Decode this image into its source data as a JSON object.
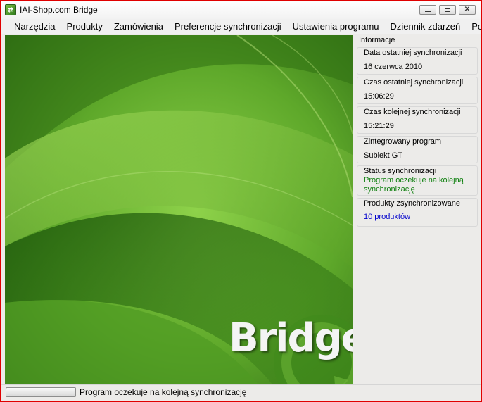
{
  "window": {
    "title": "IAI-Shop.com Bridge"
  },
  "menu": {
    "items": [
      "Narzędzia",
      "Produkty",
      "Zamówienia",
      "Preferencje synchronizacji",
      "Ustawienia programu",
      "Dziennik zdarzeń"
    ],
    "help": "Pomoc"
  },
  "banner": {
    "logo_text": "Bridge"
  },
  "info": {
    "legend": "Informacje",
    "last_sync_date": {
      "label": "Data ostatniej synchronizacji",
      "value": "16 czerwca 2010"
    },
    "last_sync_time": {
      "label": "Czas ostatniej synchronizacji",
      "value": "15:06:29"
    },
    "next_sync_time": {
      "label": "Czas kolejnej synchronizacji",
      "value": "15:21:29"
    },
    "integrated_program": {
      "label": "Zintegrowany program",
      "value": "Subiekt GT"
    },
    "sync_status": {
      "label": "Status synchronizacji",
      "value": "Program oczekuje na kolejną synchronizację"
    },
    "synced_products": {
      "label": "Produkty zsynchronizowane",
      "value": "10 produktów"
    }
  },
  "status": {
    "progress": 0,
    "text": "Program oczekuje na kolejną synchronizację"
  },
  "colors": {
    "status_green": "#108010",
    "link_blue": "#0000cc",
    "frame_red": "#e00000"
  }
}
